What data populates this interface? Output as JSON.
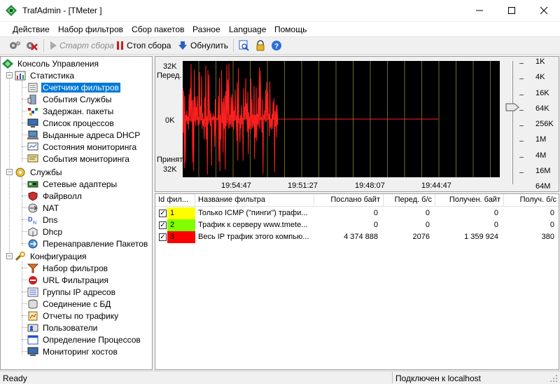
{
  "window": {
    "title": "TrafAdmin - [TMeter ]"
  },
  "menu": [
    "Действие",
    "Набор фильтров",
    "Сбор пакетов",
    "Разное",
    "Language",
    "Помощь"
  ],
  "toolbar": {
    "start": "Старт сбора",
    "stop": "Стоп сбора",
    "reset": "Обнулить"
  },
  "tree": {
    "root": "Консоль Управления",
    "stats": "Статистика",
    "stats_items": [
      "Счетчики фильтров",
      "События Службы",
      "Задержан. пакеты",
      "Список процессов",
      "Выданные адреса DHCP",
      "Состояния мониторинга",
      "События мониторинга"
    ],
    "services": "Службы",
    "services_items": [
      "Сетевые адаптеры",
      "Файрволл",
      "NAT",
      "Dns",
      "Dhcp",
      "Перенаправление Пакетов"
    ],
    "config": "Конфигурация",
    "config_items": [
      "Набор фильтров",
      "URL Фильтрация",
      "Группы IP адресов",
      "Соединение с БД",
      "Отчеты по трафику",
      "Пользователи",
      "Определение Процессов",
      "Мониторинг хостов"
    ]
  },
  "graph": {
    "top_value": "32K",
    "top_label": "Перед.",
    "mid_value": "0K",
    "bottom_label": "Принят",
    "bottom_value": "32K",
    "times": [
      "19:54:47",
      "19:51:27",
      "19:48:07",
      "19:44:47"
    ],
    "scale_labels": [
      "1K",
      "4K",
      "16K",
      "64K",
      "256K",
      "1M",
      "4M",
      "16M",
      "64M"
    ],
    "scale_selected": "64K",
    "colors": {
      "background": "#000000",
      "grid": "#6b6b2a",
      "line": "#ff2020"
    }
  },
  "table": {
    "columns": [
      "Id фил...",
      "Название фильтра",
      "Послано байт",
      "Перед. б/с",
      "Получен. байт",
      "Получ. б/с"
    ],
    "rows": [
      {
        "id": "1",
        "color": "#ffff00",
        "name": "Только ICMP (\"пинги\") трафи...",
        "sent": "0",
        "send_rate": "0",
        "recv": "0",
        "recv_rate": "0"
      },
      {
        "id": "2",
        "color": "#7fff00",
        "name": "Трафик к серверу www.tmete...",
        "sent": "0",
        "send_rate": "0",
        "recv": "0",
        "recv_rate": "0"
      },
      {
        "id": "3",
        "color": "#ff0000",
        "name": "Весь IP трафик этого компью...",
        "sent": "4 374 888",
        "send_rate": "2076",
        "recv": "1 359 924",
        "recv_rate": "380"
      }
    ]
  },
  "status": {
    "left": "Ready",
    "right": "Подключен к localhost"
  }
}
